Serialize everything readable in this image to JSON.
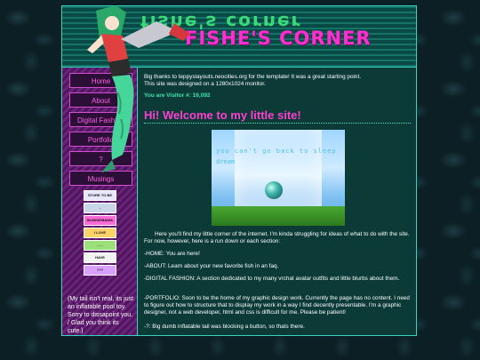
{
  "header": {
    "logo_mirrored": "fishe's corner",
    "logo_title": "FISHE'S CORNER"
  },
  "nav": {
    "items": [
      {
        "label": "Home"
      },
      {
        "label": "About"
      },
      {
        "label": "Digital Fashion"
      },
      {
        "label": "Portfolio"
      },
      {
        "label": "?"
      },
      {
        "label": "Musings"
      }
    ]
  },
  "badges": [
    {
      "text": "STORE TO BE",
      "color": "#e7e7ff"
    },
    {
      "text": "-",
      "color": "#c9d6e8"
    },
    {
      "text": "BLINKIEMANIA",
      "color": "#ff6ad8"
    },
    {
      "text": "I LOVE",
      "color": "#ffd36a"
    },
    {
      "text": "- - -",
      "color": "#9be07a"
    },
    {
      "text": "HAVE",
      "color": "#f2f2f2"
    },
    {
      "text": "???",
      "color": "#d9a1ff"
    },
    {
      "text": "!!!",
      "color": "#ff8f6a"
    },
    {
      "text": "???",
      "color": "#ffdfa1"
    }
  ],
  "sidebar": {
    "note": "(My tail isn't real, its just an inflatable pool toy. Sorry to dissapoint you. / Glad you think its cute.)"
  },
  "content": {
    "intro_line1": "Big thanks to teppyslayouts.neocities.org for the template! It was a great starting point.",
    "intro_line2": "This site was designed on a 1280x1024 monitor.",
    "visitor": "You are Visitor #: 16,092",
    "welcome": "Hi! Welcome to my little site!",
    "image_caption_line1": "you can't go back to sleep",
    "image_caption_line2": "dream",
    "para1": "Here you'll find my little corner of the internet. I'm kinda struggling for ideas of what to do with the site. For now, however, here is a run down or each section:",
    "home": "-HOME: You are here!",
    "about": "-ABOUT: Learn about your new favorite fish in an faq.",
    "fashion": "-DIGITAL FASHION: A section dedicated to my many vrchat avatar outfits and little blurbs about them.",
    "portfolio": "-PORTFOLIO: Soon to be the home of my graphic design work. Currently the page has no content. I need to figure out how to structure that to display my work in a way I find decently presentable. I'm a graphic designer, not a web developer, html and css is difficult for me. Please be patient!",
    "question": "-?: Big dumb inflatable tail was blocking a button, so thats there."
  },
  "colors": {
    "accent_pink": "#ff3fcf",
    "accent_teal": "#36d3c0",
    "sidebar_purple": "#5a1b6b"
  }
}
